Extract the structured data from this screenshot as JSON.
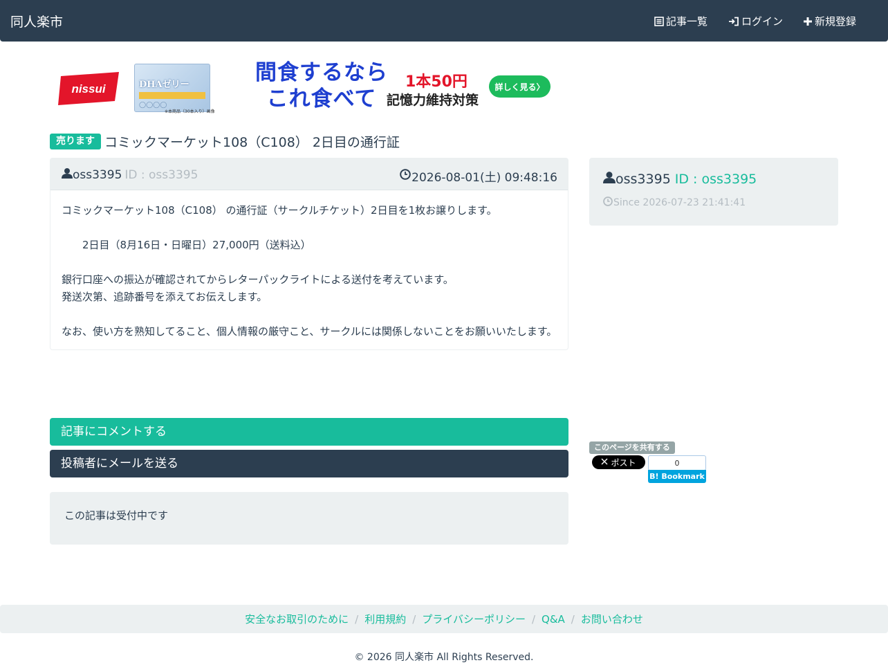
{
  "navbar": {
    "brand": "同人楽市",
    "items": [
      {
        "icon": "list-icon",
        "label": "記事一覧"
      },
      {
        "icon": "login-icon",
        "label": "ログイン"
      },
      {
        "icon": "plus-icon",
        "label": "新規登録"
      }
    ]
  },
  "ad": {
    "logo_text": "nissui",
    "product_text": "DHAゼリー",
    "product_note": "※本商品（30本入り）画像",
    "headline_line1": "間食するなら",
    "headline_line2": "これ食べて",
    "price": "1本50円",
    "subline": "記憶力維持対策",
    "cta": "詳しく見る〉",
    "colors": {
      "headline": "#1e3fd0",
      "price": "#e3152a",
      "cta": "#1dbb5c",
      "logo": "#e3152a"
    }
  },
  "post": {
    "badge": "売ります",
    "title": "コミックマーケット108（C108） 2日目の通行証",
    "author_name": "oss3395",
    "author_id": "ID : oss3395",
    "date": "2026-08-01(土) 09:48:16",
    "body_lines": [
      "コミックマーケット108（C108） の通行証（サークルチケット）2日目を1枚お譲りします。",
      "",
      "　　2日目（8月16日・日曜日）27,000円（送料込）",
      "",
      "銀行口座への振込が確認されてからレターパックライトによる送付を考えています。",
      "発送次第、追跡番号を添えてお伝えします。",
      "",
      "なお、使い方を熟知してること、個人情報の厳守こと、サークルには関係しないことをお願いいたします。"
    ]
  },
  "sidebar": {
    "user_name": "oss3395",
    "user_id": "ID : oss3395",
    "since": "Since 2026-07-23 21:41:41"
  },
  "actions": {
    "comment_label": "記事にコメントする",
    "mail_label": "投稿者にメールを送る",
    "status": "この記事は受付中です"
  },
  "share": {
    "label": "このページを共有する",
    "x_post": "ポスト",
    "hatena_count": "0",
    "hatena_label": "B! Bookmark"
  },
  "footer": {
    "links": [
      "安全なお取引のために",
      "利用規約",
      "プライバシーポリシー",
      "Q&A",
      "お問い合わせ"
    ],
    "separator": "/",
    "copyright": "© 2026 同人楽市 All Rights Reserved."
  },
  "colors": {
    "primary": "#2c3e50",
    "success": "#18bc9c",
    "light": "#ecf0f1",
    "muted": "#b4bcc2"
  }
}
